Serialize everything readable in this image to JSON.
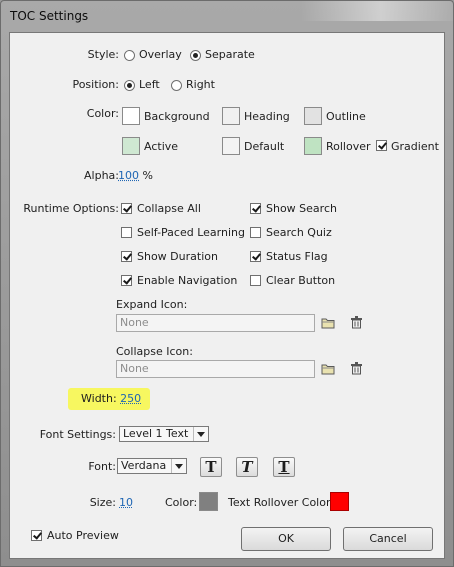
{
  "window": {
    "title": "TOC Settings"
  },
  "style": {
    "label": "Style:",
    "options": [
      "Overlay",
      "Separate"
    ],
    "selected": "Separate"
  },
  "position": {
    "label": "Position:",
    "options": [
      "Left",
      "Right"
    ],
    "selected": "Left"
  },
  "color": {
    "label": "Color:",
    "items": [
      {
        "name": "Background",
        "color": "#ffffff"
      },
      {
        "name": "Heading",
        "color": "#f0f0f0"
      },
      {
        "name": "Outline",
        "color": "#e2e2e2"
      },
      {
        "name": "Active",
        "color": "#cfe8d2"
      },
      {
        "name": "Default",
        "color": "#f3f3f3"
      },
      {
        "name": "Rollover",
        "color": "#bfe3c2"
      }
    ],
    "gradient": {
      "label": "Gradient",
      "checked": true
    }
  },
  "alpha": {
    "label": "Alpha:",
    "value": "100",
    "unit": "%"
  },
  "runtime": {
    "label": "Runtime Options:",
    "options": [
      {
        "label": "Collapse All",
        "checked": true
      },
      {
        "label": "Show Search",
        "checked": true
      },
      {
        "label": "Self-Paced Learning",
        "checked": false
      },
      {
        "label": "Search Quiz",
        "checked": false
      },
      {
        "label": "Show Duration",
        "checked": true
      },
      {
        "label": "Status Flag",
        "checked": true
      },
      {
        "label": "Enable Navigation",
        "checked": true
      },
      {
        "label": "Clear Button",
        "checked": false
      }
    ]
  },
  "expand_icon": {
    "label": "Expand Icon:",
    "placeholder": "None"
  },
  "collapse_icon": {
    "label": "Collapse Icon:",
    "placeholder": "None"
  },
  "width": {
    "label": "Width:",
    "value": "250",
    "highlight_color": "#f7f760"
  },
  "font_settings": {
    "label": "Font Settings:",
    "selected": "Level 1 Text"
  },
  "font": {
    "label": "Font:",
    "selected": "Verdana",
    "styles": [
      "T",
      "T",
      "T"
    ]
  },
  "size": {
    "label": "Size:",
    "value": "10"
  },
  "text_color": {
    "label": "Color:",
    "color": "#808080"
  },
  "rollover_color": {
    "label": "Text Rollover Color:",
    "color": "#ff0000"
  },
  "auto_preview": {
    "label": "Auto Preview",
    "checked": true
  },
  "buttons": {
    "ok": "OK",
    "cancel": "Cancel"
  }
}
